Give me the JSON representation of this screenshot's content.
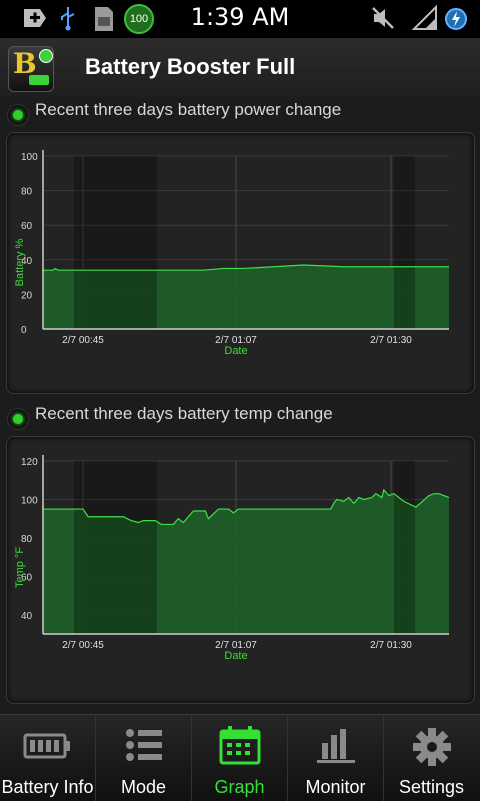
{
  "status_bar": {
    "time": "1:39 AM",
    "battery_badge": "100"
  },
  "app": {
    "title": "Battery Booster Full",
    "icon_letter": "B"
  },
  "sections": [
    {
      "label": "Recent three days battery power change"
    },
    {
      "label": "Recent three days battery temp change"
    }
  ],
  "chart_data": [
    {
      "type": "area",
      "ylabel": "Battery %",
      "xlabel": "Date",
      "yticks": [
        "100",
        "80",
        "60",
        "40",
        "20",
        "0"
      ],
      "ylim": [
        0,
        100
      ],
      "xticks": [
        "2/7 00:45",
        "2/7 01:07",
        "2/7 01:30"
      ],
      "grid": true,
      "color": "#2fbf3a",
      "x": [
        0,
        10,
        12,
        15,
        40,
        100,
        160,
        180,
        200,
        260,
        300,
        405
      ],
      "y": [
        34,
        34,
        35,
        34,
        34,
        34,
        34,
        35,
        35,
        37,
        36,
        36
      ]
    },
    {
      "type": "area",
      "ylabel": "Temp °F",
      "xlabel": "Date",
      "yticks": [
        "120",
        "100",
        "80",
        "60",
        "40"
      ],
      "ylim": [
        30,
        120
      ],
      "xticks": [
        "2/7 00:45",
        "2/7 01:07",
        "2/7 01:30"
      ],
      "grid": true,
      "color": "#2fbf3a",
      "x": [
        0,
        40,
        45,
        80,
        88,
        95,
        100,
        112,
        118,
        122,
        125,
        130,
        135,
        140,
        145,
        150,
        162,
        165,
        175,
        185,
        190,
        195,
        287,
        290,
        293,
        300,
        305,
        310,
        312,
        315,
        320,
        328,
        332,
        338,
        340,
        345,
        350,
        360,
        372,
        385,
        390,
        395,
        405
      ],
      "y": [
        95,
        95,
        91,
        91,
        89,
        88,
        89,
        89,
        87,
        87,
        87,
        87,
        90,
        88,
        91,
        94,
        94,
        90,
        95,
        95,
        93,
        95,
        95,
        98,
        100,
        99,
        101,
        98,
        99,
        101,
        100,
        101,
        103,
        101,
        105,
        102,
        103,
        99,
        96,
        102,
        103,
        103,
        101
      ]
    }
  ],
  "tabs": [
    {
      "label": "Battery Info",
      "icon": "battery-icon"
    },
    {
      "label": "Mode",
      "icon": "list-icon"
    },
    {
      "label": "Graph",
      "icon": "calendar-icon",
      "active": true
    },
    {
      "label": "Monitor",
      "icon": "bar-chart-icon"
    },
    {
      "label": "Settings",
      "icon": "gear-icon"
    }
  ]
}
